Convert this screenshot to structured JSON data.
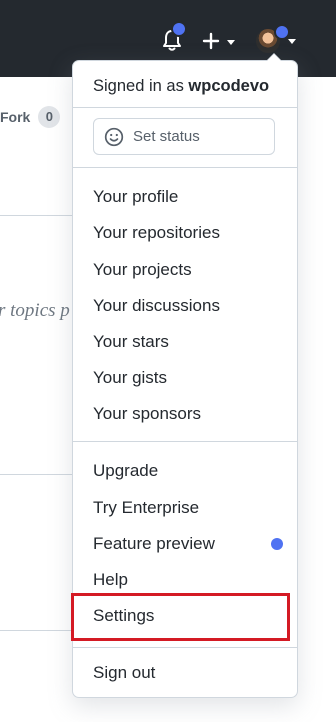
{
  "header": {
    "bell_icon": "bell-icon",
    "plus_icon": "plus-icon",
    "avatar": "user-avatar",
    "accent_dot_color": "#4f72f2",
    "bar_color": "#24292f"
  },
  "background": {
    "fork_label": "Fork",
    "fork_count": "0",
    "topics_text": "r topics p"
  },
  "dropdown": {
    "signed_in_prefix": "Signed in as ",
    "username": "wpcodevo",
    "set_status_label": "Set status",
    "set_status_icon": "smiley-icon",
    "items": [
      {
        "label": "Your profile"
      },
      {
        "label": "Your repositories"
      },
      {
        "label": "Your projects"
      },
      {
        "label": "Your discussions"
      },
      {
        "label": "Your stars"
      },
      {
        "label": "Your gists"
      },
      {
        "label": "Your sponsors"
      },
      {
        "label": "Upgrade"
      },
      {
        "label": "Try Enterprise"
      },
      {
        "label": "Feature preview"
      },
      {
        "label": "Help"
      },
      {
        "label": "Settings"
      },
      {
        "label": "Sign out"
      }
    ],
    "feature_preview_dot_color": "#4f72f2",
    "highlight_color": "#d41a24"
  }
}
